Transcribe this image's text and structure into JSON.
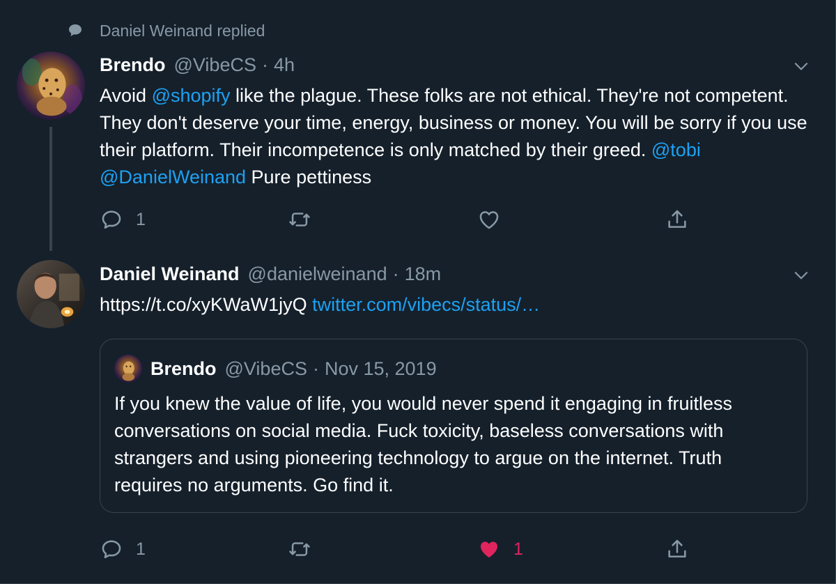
{
  "context": {
    "icon": "comment-bubble-icon",
    "text": "Daniel Weinand replied"
  },
  "tweet1": {
    "name": "Brendo",
    "handle": "@VibeCS",
    "separator": "·",
    "time": "4h",
    "text_parts": {
      "p1": "Avoid ",
      "mention_shopify": "@shopify",
      "p2": " like the plague.  These folks are not ethical.   They're not competent.  They don't deserve your time, energy, business or money.  You will be sorry if you use their platform.  Their incompetence is only matched by their greed. ",
      "mention_tobi": "@tobi",
      "space": " ",
      "mention_daniel": "@DanielWeinand",
      "p3": " Pure pettiness"
    },
    "reply_count": "1",
    "retweet_count": "",
    "like_count": ""
  },
  "tweet2": {
    "name": "Daniel Weinand",
    "handle": "@danielweinand",
    "separator": "·",
    "time": "18m",
    "text": "https://t.co/xyKWaW1jyQ ",
    "link": "twitter.com/vibecs/status/…",
    "quote": {
      "name": "Brendo",
      "handle": "@VibeCS",
      "separator": "·",
      "date": "Nov 15, 2019",
      "text": "If you knew the value of life, you would never spend it engaging in fruitless conversations on social media.  Fuck toxicity, baseless conversations with strangers and using pioneering technology to argue on the internet.  Truth requires no arguments.  Go find it."
    },
    "reply_count": "1",
    "retweet_count": "",
    "like_count": "1"
  },
  "colors": {
    "background": "#15202b",
    "border": "#38444d",
    "secondary_text": "#8899a6",
    "link": "#1da1f2",
    "like_active": "#e0245e"
  },
  "icons": {
    "reply": "reply-icon",
    "retweet": "retweet-icon",
    "like": "heart-icon",
    "share": "share-icon",
    "caret": "chevron-down-icon"
  }
}
